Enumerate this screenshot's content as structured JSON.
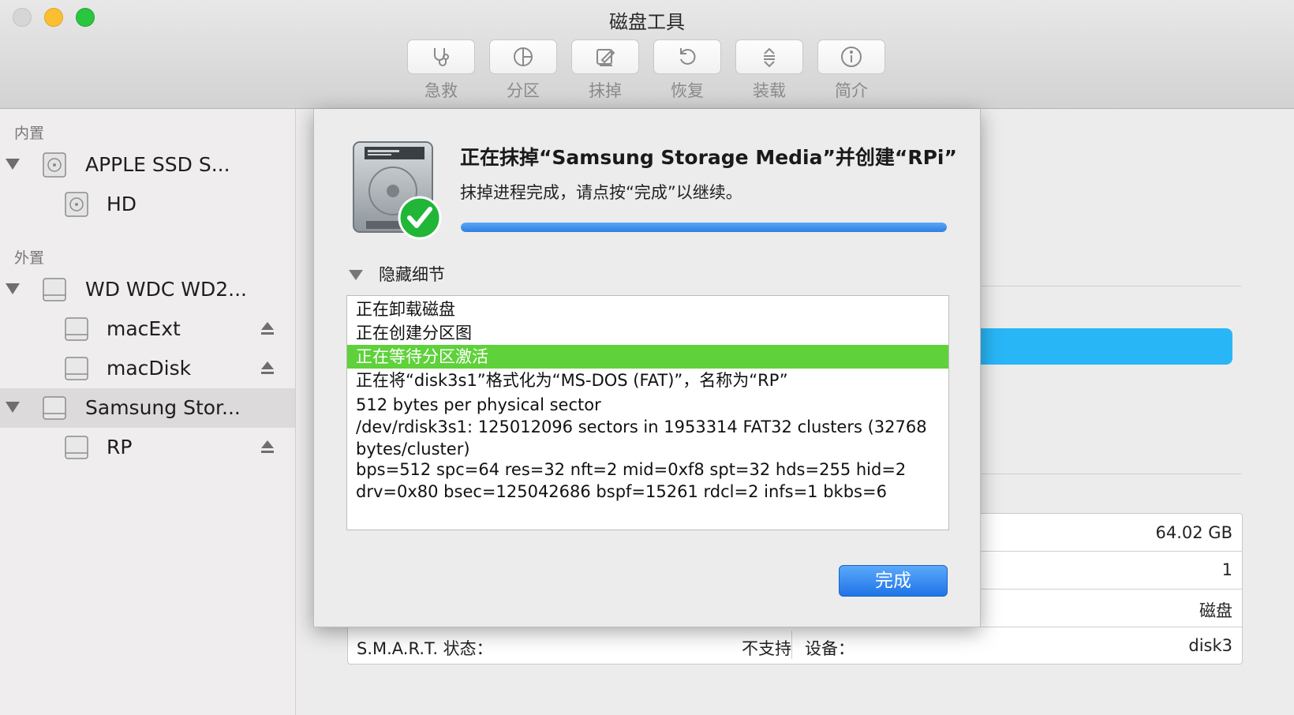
{
  "window": {
    "title": "磁盘工具"
  },
  "toolbar": [
    {
      "label": "急救",
      "icon": "stethoscope-icon"
    },
    {
      "label": "分区",
      "icon": "pie-chart-icon"
    },
    {
      "label": "抹掉",
      "icon": "erase-icon"
    },
    {
      "label": "恢复",
      "icon": "restore-icon"
    },
    {
      "label": "装载",
      "icon": "mount-icon"
    },
    {
      "label": "简介",
      "icon": "info-icon"
    }
  ],
  "sidebar": {
    "internal_header": "内置",
    "external_header": "外置",
    "internal": [
      {
        "label": "APPLE SSD S...",
        "children": [
          {
            "label": "HD"
          }
        ]
      }
    ],
    "external": [
      {
        "label": "WD WDC WD2...",
        "children": [
          {
            "label": "macExt"
          },
          {
            "label": "macDisk"
          }
        ]
      },
      {
        "label": "Samsung Stor...",
        "selected": true,
        "children": [
          {
            "label": "RP"
          }
        ]
      }
    ]
  },
  "info_table": {
    "capacity": "64.02 GB",
    "child_count": "1",
    "type": "磁盘",
    "smart_label": "S.M.A.R.T. 状态：",
    "smart_value": "不支持",
    "device_label": "设备：",
    "device_value": "disk3"
  },
  "dialog": {
    "title": "正在抹掉“Samsung Storage Media”并创建“RPi”",
    "message": "抹掉进程完成，请点按“完成”以继续。",
    "progress": 1.0,
    "details_toggle": "隐藏细节",
    "log": [
      "正在卸载磁盘",
      "正在创建分区图",
      "正在等待分区激活",
      "正在将“disk3s1”格式化为“MS-DOS (FAT)”，名称为“RP”",
      "512 bytes per physical sector",
      "/dev/rdisk3s1: 125012096 sectors in 1953314 FAT32 clusters (32768 bytes/cluster)",
      "bps=512 spc=64 res=32 nft=2 mid=0xf8 spt=32 hds=255 hid=2 drv=0x80 bsec=125042686 bspf=15261 rdcl=2 infs=1 bkbs=6"
    ],
    "highlighted_log_index": 2,
    "done_button": "完成"
  },
  "colors": {
    "accent_blue": "#2e7fe0",
    "highlight_green": "#5fd13b",
    "bg_bar_blue": "#29b6f6"
  }
}
